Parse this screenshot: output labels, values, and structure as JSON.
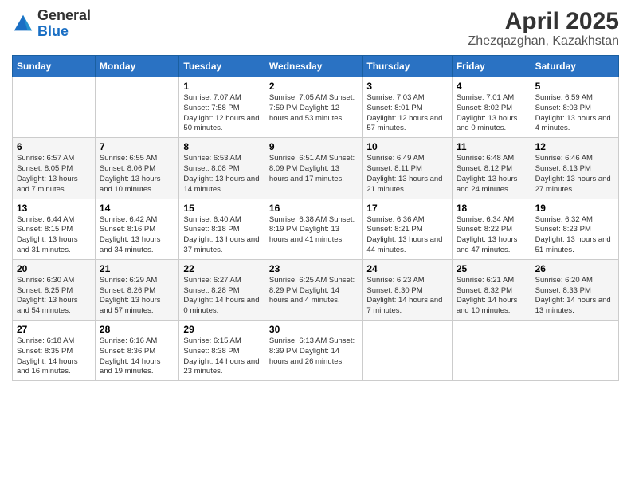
{
  "header": {
    "logo_general": "General",
    "logo_blue": "Blue",
    "title": "April 2025",
    "subtitle": "Zhezqazghan, Kazakhstan"
  },
  "weekdays": [
    "Sunday",
    "Monday",
    "Tuesday",
    "Wednesday",
    "Thursday",
    "Friday",
    "Saturday"
  ],
  "weeks": [
    [
      {
        "day": "",
        "info": ""
      },
      {
        "day": "",
        "info": ""
      },
      {
        "day": "1",
        "info": "Sunrise: 7:07 AM\nSunset: 7:58 PM\nDaylight: 12 hours and 50 minutes."
      },
      {
        "day": "2",
        "info": "Sunrise: 7:05 AM\nSunset: 7:59 PM\nDaylight: 12 hours and 53 minutes."
      },
      {
        "day": "3",
        "info": "Sunrise: 7:03 AM\nSunset: 8:01 PM\nDaylight: 12 hours and 57 minutes."
      },
      {
        "day": "4",
        "info": "Sunrise: 7:01 AM\nSunset: 8:02 PM\nDaylight: 13 hours and 0 minutes."
      },
      {
        "day": "5",
        "info": "Sunrise: 6:59 AM\nSunset: 8:03 PM\nDaylight: 13 hours and 4 minutes."
      }
    ],
    [
      {
        "day": "6",
        "info": "Sunrise: 6:57 AM\nSunset: 8:05 PM\nDaylight: 13 hours and 7 minutes."
      },
      {
        "day": "7",
        "info": "Sunrise: 6:55 AM\nSunset: 8:06 PM\nDaylight: 13 hours and 10 minutes."
      },
      {
        "day": "8",
        "info": "Sunrise: 6:53 AM\nSunset: 8:08 PM\nDaylight: 13 hours and 14 minutes."
      },
      {
        "day": "9",
        "info": "Sunrise: 6:51 AM\nSunset: 8:09 PM\nDaylight: 13 hours and 17 minutes."
      },
      {
        "day": "10",
        "info": "Sunrise: 6:49 AM\nSunset: 8:11 PM\nDaylight: 13 hours and 21 minutes."
      },
      {
        "day": "11",
        "info": "Sunrise: 6:48 AM\nSunset: 8:12 PM\nDaylight: 13 hours and 24 minutes."
      },
      {
        "day": "12",
        "info": "Sunrise: 6:46 AM\nSunset: 8:13 PM\nDaylight: 13 hours and 27 minutes."
      }
    ],
    [
      {
        "day": "13",
        "info": "Sunrise: 6:44 AM\nSunset: 8:15 PM\nDaylight: 13 hours and 31 minutes."
      },
      {
        "day": "14",
        "info": "Sunrise: 6:42 AM\nSunset: 8:16 PM\nDaylight: 13 hours and 34 minutes."
      },
      {
        "day": "15",
        "info": "Sunrise: 6:40 AM\nSunset: 8:18 PM\nDaylight: 13 hours and 37 minutes."
      },
      {
        "day": "16",
        "info": "Sunrise: 6:38 AM\nSunset: 8:19 PM\nDaylight: 13 hours and 41 minutes."
      },
      {
        "day": "17",
        "info": "Sunrise: 6:36 AM\nSunset: 8:21 PM\nDaylight: 13 hours and 44 minutes."
      },
      {
        "day": "18",
        "info": "Sunrise: 6:34 AM\nSunset: 8:22 PM\nDaylight: 13 hours and 47 minutes."
      },
      {
        "day": "19",
        "info": "Sunrise: 6:32 AM\nSunset: 8:23 PM\nDaylight: 13 hours and 51 minutes."
      }
    ],
    [
      {
        "day": "20",
        "info": "Sunrise: 6:30 AM\nSunset: 8:25 PM\nDaylight: 13 hours and 54 minutes."
      },
      {
        "day": "21",
        "info": "Sunrise: 6:29 AM\nSunset: 8:26 PM\nDaylight: 13 hours and 57 minutes."
      },
      {
        "day": "22",
        "info": "Sunrise: 6:27 AM\nSunset: 8:28 PM\nDaylight: 14 hours and 0 minutes."
      },
      {
        "day": "23",
        "info": "Sunrise: 6:25 AM\nSunset: 8:29 PM\nDaylight: 14 hours and 4 minutes."
      },
      {
        "day": "24",
        "info": "Sunrise: 6:23 AM\nSunset: 8:30 PM\nDaylight: 14 hours and 7 minutes."
      },
      {
        "day": "25",
        "info": "Sunrise: 6:21 AM\nSunset: 8:32 PM\nDaylight: 14 hours and 10 minutes."
      },
      {
        "day": "26",
        "info": "Sunrise: 6:20 AM\nSunset: 8:33 PM\nDaylight: 14 hours and 13 minutes."
      }
    ],
    [
      {
        "day": "27",
        "info": "Sunrise: 6:18 AM\nSunset: 8:35 PM\nDaylight: 14 hours and 16 minutes."
      },
      {
        "day": "28",
        "info": "Sunrise: 6:16 AM\nSunset: 8:36 PM\nDaylight: 14 hours and 19 minutes."
      },
      {
        "day": "29",
        "info": "Sunrise: 6:15 AM\nSunset: 8:38 PM\nDaylight: 14 hours and 23 minutes."
      },
      {
        "day": "30",
        "info": "Sunrise: 6:13 AM\nSunset: 8:39 PM\nDaylight: 14 hours and 26 minutes."
      },
      {
        "day": "",
        "info": ""
      },
      {
        "day": "",
        "info": ""
      },
      {
        "day": "",
        "info": ""
      }
    ]
  ]
}
